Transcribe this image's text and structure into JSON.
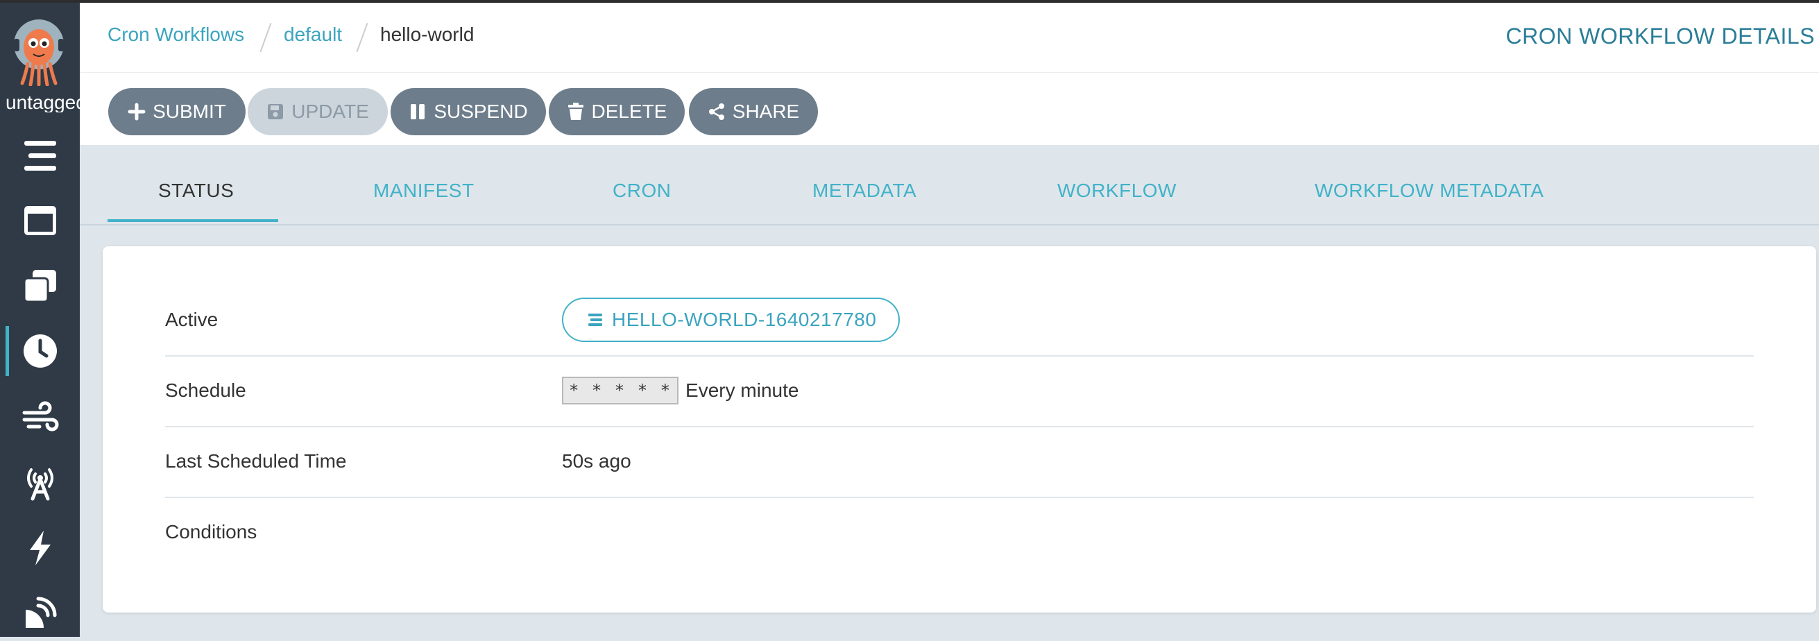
{
  "sidebar": {
    "version_label": "untagged",
    "items": [
      {
        "icon": "stream-icon",
        "label": "Workflows"
      },
      {
        "icon": "window-icon",
        "label": "Workflow Templates"
      },
      {
        "icon": "clone-icon",
        "label": "Cluster Workflow Templates"
      },
      {
        "icon": "clock-icon",
        "label": "Cron Workflows",
        "active": true
      },
      {
        "icon": "wind-icon",
        "label": "Event Flow"
      },
      {
        "icon": "broadcast-tower-icon",
        "label": "Event Sources"
      },
      {
        "icon": "bolt-icon",
        "label": "Sensors"
      },
      {
        "icon": "satellite-dish-icon",
        "label": "Archived Workflows"
      }
    ],
    "accent_color": "#42b2c8"
  },
  "breadcrumb": {
    "items": [
      "Cron Workflows",
      "default"
    ],
    "current": "hello-world"
  },
  "page_title": "CRON WORKFLOW DETAILS",
  "toolbar": {
    "submit_label": "SUBMIT",
    "update_label": "UPDATE",
    "suspend_label": "SUSPEND",
    "delete_label": "DELETE",
    "share_label": "SHARE"
  },
  "tabs": [
    "STATUS",
    "MANIFEST",
    "CRON",
    "METADATA",
    "WORKFLOW",
    "WORKFLOW METADATA"
  ],
  "active_tab": "STATUS",
  "status": {
    "active_label": "Active",
    "active_workflow": "HELLO-WORLD-1640217780",
    "schedule_label": "Schedule",
    "schedule_expr": "* * * * *",
    "schedule_text": "Every minute",
    "last_scheduled_label": "Last Scheduled Time",
    "last_scheduled_value": "50s ago",
    "conditions_label": "Conditions"
  }
}
